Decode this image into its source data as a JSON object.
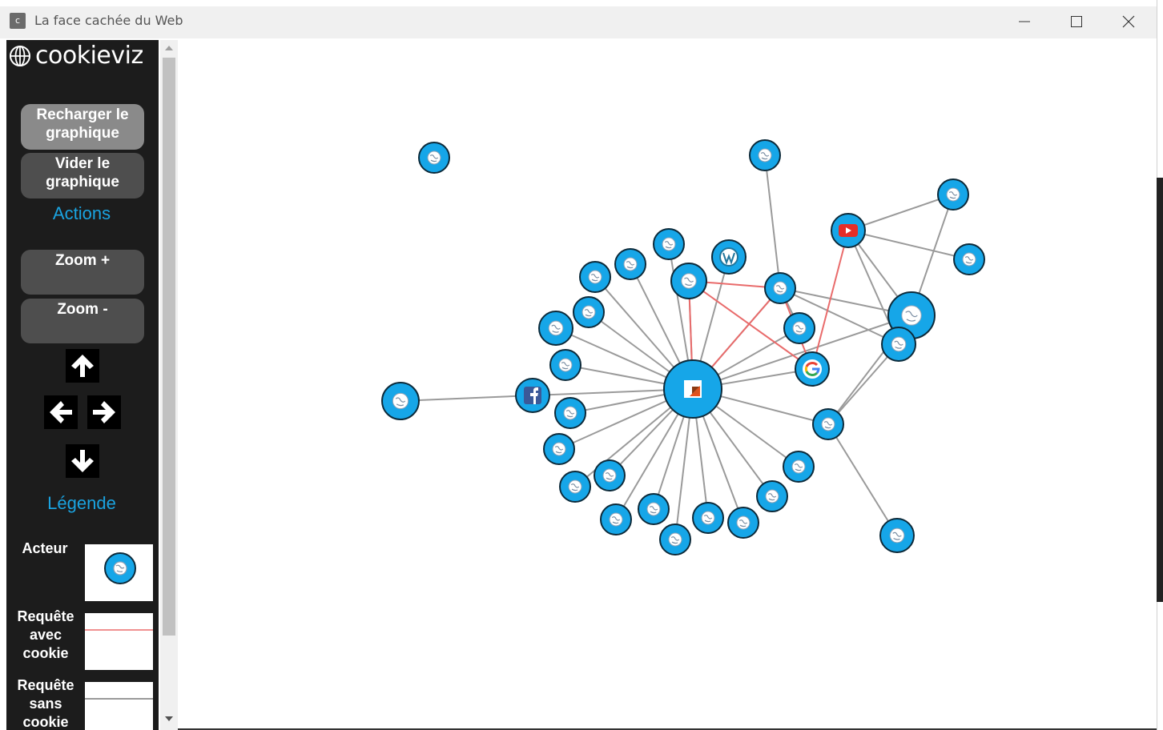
{
  "window": {
    "title": "La face cachée du Web",
    "icon_letter": "c",
    "controls": [
      "minimize-icon",
      "maximize-icon",
      "close-icon"
    ]
  },
  "sidebar": {
    "logo_text": "cookieviz",
    "logo_icon": "globe-icon",
    "buttons": {
      "reload": "Recharger le graphique",
      "clear": "Vider le graphique",
      "zoom_in": "Zoom +",
      "zoom_out": "Zoom -"
    },
    "actions_title": "Actions",
    "navigation": [
      "arrow-up-icon",
      "arrow-left-icon",
      "arrow-right-icon",
      "arrow-down-icon"
    ],
    "legend": {
      "title": "Légende",
      "actor": "Acteur",
      "request_with_cookie": "Requête avec cookie",
      "request_without_cookie": "Requête sans cookie"
    },
    "colors": {
      "background": "#1c1c1c",
      "accent": "#1aa3e0",
      "cookie_link": "#f09090",
      "nocookie_link": "#9a9a9a",
      "node": "#16a6e8"
    }
  },
  "graph": {
    "node_icons": {
      "default": "globe-icon",
      "center": "site-logo-icon",
      "facebook": "facebook-icon",
      "google": "google-icon",
      "youtube": "youtube-icon",
      "wordpress": "wordpress-icon"
    }
  }
}
